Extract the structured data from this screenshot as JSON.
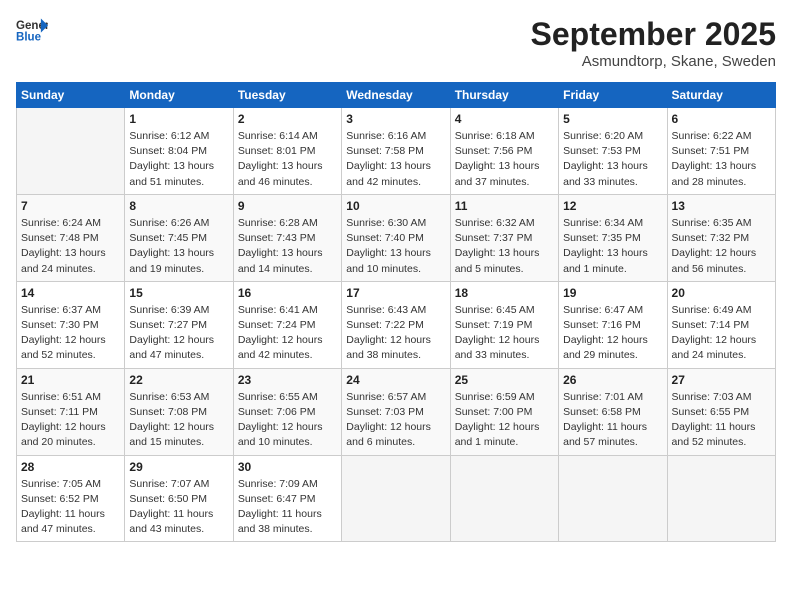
{
  "header": {
    "logo_line1": "General",
    "logo_line2": "Blue",
    "month": "September 2025",
    "location": "Asmundtorp, Skane, Sweden"
  },
  "weekdays": [
    "Sunday",
    "Monday",
    "Tuesday",
    "Wednesday",
    "Thursday",
    "Friday",
    "Saturday"
  ],
  "weeks": [
    [
      {
        "day": "",
        "info": ""
      },
      {
        "day": "1",
        "info": "Sunrise: 6:12 AM\nSunset: 8:04 PM\nDaylight: 13 hours\nand 51 minutes."
      },
      {
        "day": "2",
        "info": "Sunrise: 6:14 AM\nSunset: 8:01 PM\nDaylight: 13 hours\nand 46 minutes."
      },
      {
        "day": "3",
        "info": "Sunrise: 6:16 AM\nSunset: 7:58 PM\nDaylight: 13 hours\nand 42 minutes."
      },
      {
        "day": "4",
        "info": "Sunrise: 6:18 AM\nSunset: 7:56 PM\nDaylight: 13 hours\nand 37 minutes."
      },
      {
        "day": "5",
        "info": "Sunrise: 6:20 AM\nSunset: 7:53 PM\nDaylight: 13 hours\nand 33 minutes."
      },
      {
        "day": "6",
        "info": "Sunrise: 6:22 AM\nSunset: 7:51 PM\nDaylight: 13 hours\nand 28 minutes."
      }
    ],
    [
      {
        "day": "7",
        "info": "Sunrise: 6:24 AM\nSunset: 7:48 PM\nDaylight: 13 hours\nand 24 minutes."
      },
      {
        "day": "8",
        "info": "Sunrise: 6:26 AM\nSunset: 7:45 PM\nDaylight: 13 hours\nand 19 minutes."
      },
      {
        "day": "9",
        "info": "Sunrise: 6:28 AM\nSunset: 7:43 PM\nDaylight: 13 hours\nand 14 minutes."
      },
      {
        "day": "10",
        "info": "Sunrise: 6:30 AM\nSunset: 7:40 PM\nDaylight: 13 hours\nand 10 minutes."
      },
      {
        "day": "11",
        "info": "Sunrise: 6:32 AM\nSunset: 7:37 PM\nDaylight: 13 hours\nand 5 minutes."
      },
      {
        "day": "12",
        "info": "Sunrise: 6:34 AM\nSunset: 7:35 PM\nDaylight: 13 hours\nand 1 minute."
      },
      {
        "day": "13",
        "info": "Sunrise: 6:35 AM\nSunset: 7:32 PM\nDaylight: 12 hours\nand 56 minutes."
      }
    ],
    [
      {
        "day": "14",
        "info": "Sunrise: 6:37 AM\nSunset: 7:30 PM\nDaylight: 12 hours\nand 52 minutes."
      },
      {
        "day": "15",
        "info": "Sunrise: 6:39 AM\nSunset: 7:27 PM\nDaylight: 12 hours\nand 47 minutes."
      },
      {
        "day": "16",
        "info": "Sunrise: 6:41 AM\nSunset: 7:24 PM\nDaylight: 12 hours\nand 42 minutes."
      },
      {
        "day": "17",
        "info": "Sunrise: 6:43 AM\nSunset: 7:22 PM\nDaylight: 12 hours\nand 38 minutes."
      },
      {
        "day": "18",
        "info": "Sunrise: 6:45 AM\nSunset: 7:19 PM\nDaylight: 12 hours\nand 33 minutes."
      },
      {
        "day": "19",
        "info": "Sunrise: 6:47 AM\nSunset: 7:16 PM\nDaylight: 12 hours\nand 29 minutes."
      },
      {
        "day": "20",
        "info": "Sunrise: 6:49 AM\nSunset: 7:14 PM\nDaylight: 12 hours\nand 24 minutes."
      }
    ],
    [
      {
        "day": "21",
        "info": "Sunrise: 6:51 AM\nSunset: 7:11 PM\nDaylight: 12 hours\nand 20 minutes."
      },
      {
        "day": "22",
        "info": "Sunrise: 6:53 AM\nSunset: 7:08 PM\nDaylight: 12 hours\nand 15 minutes."
      },
      {
        "day": "23",
        "info": "Sunrise: 6:55 AM\nSunset: 7:06 PM\nDaylight: 12 hours\nand 10 minutes."
      },
      {
        "day": "24",
        "info": "Sunrise: 6:57 AM\nSunset: 7:03 PM\nDaylight: 12 hours\nand 6 minutes."
      },
      {
        "day": "25",
        "info": "Sunrise: 6:59 AM\nSunset: 7:00 PM\nDaylight: 12 hours\nand 1 minute."
      },
      {
        "day": "26",
        "info": "Sunrise: 7:01 AM\nSunset: 6:58 PM\nDaylight: 11 hours\nand 57 minutes."
      },
      {
        "day": "27",
        "info": "Sunrise: 7:03 AM\nSunset: 6:55 PM\nDaylight: 11 hours\nand 52 minutes."
      }
    ],
    [
      {
        "day": "28",
        "info": "Sunrise: 7:05 AM\nSunset: 6:52 PM\nDaylight: 11 hours\nand 47 minutes."
      },
      {
        "day": "29",
        "info": "Sunrise: 7:07 AM\nSunset: 6:50 PM\nDaylight: 11 hours\nand 43 minutes."
      },
      {
        "day": "30",
        "info": "Sunrise: 7:09 AM\nSunset: 6:47 PM\nDaylight: 11 hours\nand 38 minutes."
      },
      {
        "day": "",
        "info": ""
      },
      {
        "day": "",
        "info": ""
      },
      {
        "day": "",
        "info": ""
      },
      {
        "day": "",
        "info": ""
      }
    ]
  ]
}
